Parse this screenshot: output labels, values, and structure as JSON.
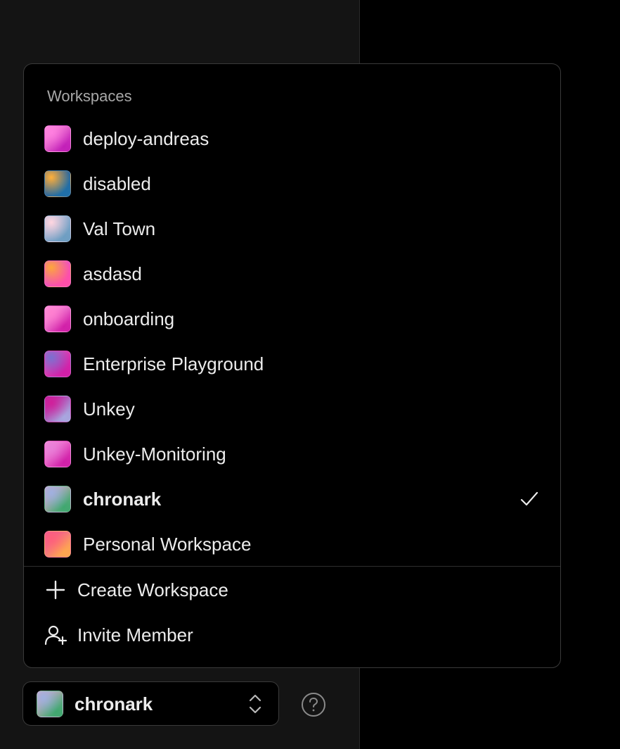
{
  "menu": {
    "heading": "Workspaces",
    "workspaces": [
      {
        "name": "deploy-andreas",
        "active": false,
        "avatar_gradient": [
          "#ff7fe0",
          "#c21fb8",
          "#ff9ad8"
        ]
      },
      {
        "name": "disabled",
        "active": false,
        "avatar_gradient": [
          "#ffb03a",
          "#1f6fa8",
          "#3a5e8f"
        ]
      },
      {
        "name": "Val Town",
        "active": false,
        "avatar_gradient": [
          "#ffd6e0",
          "#6e9ec2",
          "#a3b4d8"
        ]
      },
      {
        "name": "asdasd",
        "active": false,
        "avatar_gradient": [
          "#ffa63a",
          "#ff4fa8",
          "#e04fd8"
        ]
      },
      {
        "name": "onboarding",
        "active": false,
        "avatar_gradient": [
          "#ff7fd0",
          "#d11fa8",
          "#ffb0e8"
        ]
      },
      {
        "name": "Enterprise Playground",
        "active": false,
        "avatar_gradient": [
          "#7a6fd0",
          "#d11fa8",
          "#e84fb8"
        ]
      },
      {
        "name": "Unkey",
        "active": false,
        "avatar_gradient": [
          "#d11f9a",
          "#a8a8e0",
          "#b01fa0"
        ]
      },
      {
        "name": "Unkey-Monitoring",
        "active": false,
        "avatar_gradient": [
          "#e87fd8",
          "#d11fa8",
          "#ff9ae0"
        ]
      },
      {
        "name": "chronark",
        "active": true,
        "avatar_gradient": [
          "#9fb0e0",
          "#3fa86f",
          "#e8a8c8"
        ]
      },
      {
        "name": "Personal Workspace",
        "active": false,
        "avatar_gradient": [
          "#ff5f7a",
          "#ffa84f",
          "#e84fa8"
        ]
      }
    ],
    "actions": [
      {
        "label": "Create Workspace",
        "icon": "plus-icon"
      },
      {
        "label": "Invite Member",
        "icon": "user-plus-icon"
      }
    ]
  },
  "switcher": {
    "current": "chronark",
    "avatar_gradient": [
      "#9fb0e0",
      "#3fa86f",
      "#e8a8c8"
    ]
  },
  "colors": {
    "sidebar_bg": "#141414",
    "menu_bg": "#000000",
    "border": "#3a3a3a",
    "text": "#ececec",
    "muted_text": "#a8a8a8"
  }
}
